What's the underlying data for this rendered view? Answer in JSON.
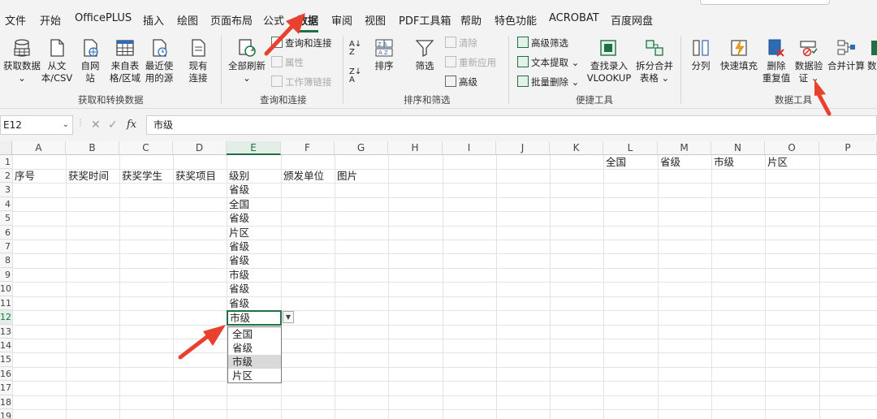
{
  "menu": {
    "items": [
      "文件",
      "开始",
      "OfficePLUS",
      "插入",
      "绘图",
      "页面布局",
      "公式",
      "数据",
      "审阅",
      "视图",
      "PDF工具箱",
      "帮助",
      "特色功能",
      "ACROBAT",
      "百度网盘"
    ],
    "active": "数据"
  },
  "ribbon": {
    "get_data": "获取数据",
    "from_text_csv": "从文本/CSV",
    "from_web": "自网站",
    "from_table": "来自表格/区域",
    "recent_sources": "最近使用的源",
    "existing_connections": "现有连接",
    "group_get_transform": "获取和转换数据",
    "refresh_all": "全部刷新",
    "queries_connections": "查询和连接",
    "properties": "属性",
    "workbook_links": "工作簿链接",
    "group_queries": "查询和连接",
    "sort": "排序",
    "filter": "筛选",
    "clear": "清除",
    "reapply": "重新应用",
    "advanced": "高级",
    "group_sort_filter": "排序和筛选",
    "advanced_filter": "高级筛选",
    "text_extract": "文本提取",
    "batch_delete": "批量删除",
    "vlookup_top": "查找录入",
    "vlookup_bottom": "VLOOKUP",
    "split_merge_top": "拆分合并",
    "split_merge_bottom": "表格",
    "group_convenience": "便捷工具",
    "text_to_columns": "分列",
    "flash_fill": "快速填充",
    "remove_dup_top": "删除",
    "remove_dup_bottom": "重复值",
    "data_validation_top": "数据验",
    "data_validation_bottom": "证",
    "consolidate": "合并计算",
    "group_data_tools": "数据工具",
    "cut_off": "数"
  },
  "formula_bar": {
    "name_box": "E12",
    "fx": "fx",
    "content": "市级"
  },
  "columns": [
    "A",
    "B",
    "C",
    "D",
    "E",
    "F",
    "G",
    "H",
    "I",
    "J",
    "K",
    "L",
    "M",
    "N",
    "O",
    "P"
  ],
  "rows": [
    "1",
    "2",
    "3",
    "4",
    "5",
    "6",
    "7",
    "8",
    "9",
    "10",
    "11",
    "12",
    "13",
    "14",
    "15",
    "16",
    "17",
    "18",
    "19"
  ],
  "headers_row2": [
    "序号",
    "获奖时间",
    "获奖学生",
    "获奖项目",
    "级别",
    "颁发单位",
    "图片"
  ],
  "list_row1": [
    "全国",
    "省级",
    "市级",
    "片区"
  ],
  "level_values": [
    "省级",
    "全国",
    "省级",
    "片区",
    "省级",
    "省级",
    "市级",
    "省级",
    "省级"
  ],
  "active_cell_value": "市级",
  "dropdown_options": [
    "全国",
    "省级",
    "市级",
    "片区"
  ],
  "dropdown_selected": "市级",
  "colors": {
    "accent": "#1e7145",
    "arrow": "#e8412f"
  }
}
